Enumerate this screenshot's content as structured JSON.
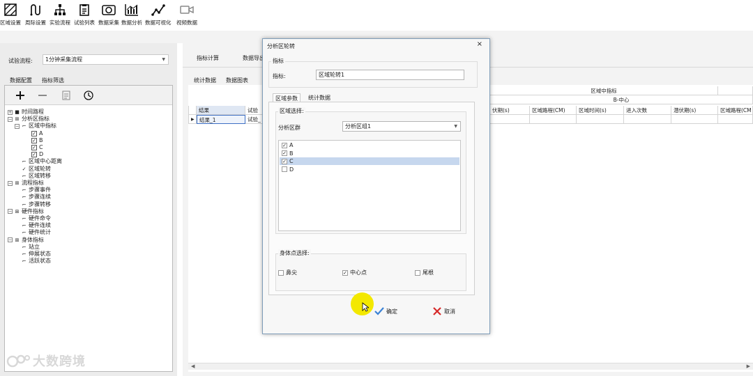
{
  "toolbar": {
    "items": [
      {
        "label": "区域设置",
        "icon": "region-hatch-icon"
      },
      {
        "label": "周际设置",
        "icon": "interval-cycle-icon"
      },
      {
        "label": "实验流程",
        "icon": "flow-tree-icon"
      },
      {
        "label": "试验列表",
        "icon": "clipboard-list-icon"
      },
      {
        "label": "数据采集",
        "icon": "camera-icon"
      },
      {
        "label": "数据分析",
        "icon": "bar-chart-icon"
      },
      {
        "label": "数据可视化",
        "icon": "line-chart-icon"
      },
      {
        "label": "视频数据",
        "icon": "video-icon"
      }
    ]
  },
  "left": {
    "flow_label": "试验流程:",
    "flow_value": "1分钟采集流程",
    "tabs": [
      "数据配置",
      "指标筛选"
    ],
    "active_tab": 1,
    "tree": [
      {
        "label": "时间路程",
        "level": 0,
        "kind": "root",
        "exp": "+",
        "glyph": "square"
      },
      {
        "label": "分析区指标",
        "level": 0,
        "kind": "root",
        "exp": "-",
        "glyph": "grid"
      },
      {
        "label": "区域中指标",
        "level": 1,
        "kind": "node",
        "exp": "-",
        "glyph": "doc"
      },
      {
        "label": "A",
        "level": 2,
        "kind": "check",
        "checked": true
      },
      {
        "label": "B",
        "level": 2,
        "kind": "check",
        "checked": true
      },
      {
        "label": "C",
        "level": 2,
        "kind": "check",
        "checked": true
      },
      {
        "label": "D",
        "level": 2,
        "kind": "check",
        "checked": true
      },
      {
        "label": "区域中心距离",
        "level": 1,
        "kind": "node",
        "glyph": "doc"
      },
      {
        "label": "区域轮转",
        "level": 1,
        "kind": "node",
        "glyph": "tick"
      },
      {
        "label": "区域转移",
        "level": 1,
        "kind": "node",
        "glyph": "doc"
      },
      {
        "label": "流程指标",
        "level": 0,
        "kind": "root",
        "exp": "-",
        "glyph": "grid"
      },
      {
        "label": "步骤事件",
        "level": 1,
        "kind": "node",
        "glyph": "doc"
      },
      {
        "label": "步骤连续",
        "level": 1,
        "kind": "node",
        "glyph": "doc"
      },
      {
        "label": "步骤转移",
        "level": 1,
        "kind": "node",
        "glyph": "doc"
      },
      {
        "label": "硬件指标",
        "level": 0,
        "kind": "root",
        "exp": "-",
        "glyph": "grid"
      },
      {
        "label": "硬件命令",
        "level": 1,
        "kind": "node",
        "glyph": "doc"
      },
      {
        "label": "硬件连续",
        "level": 1,
        "kind": "node",
        "glyph": "doc"
      },
      {
        "label": "硬件统计",
        "level": 1,
        "kind": "node",
        "glyph": "doc"
      },
      {
        "label": "身体指标",
        "level": 0,
        "kind": "root",
        "exp": "-",
        "glyph": "grid"
      },
      {
        "label": "站立",
        "level": 1,
        "kind": "node",
        "glyph": "doc"
      },
      {
        "label": "伸展状态",
        "level": 1,
        "kind": "node",
        "glyph": "doc"
      },
      {
        "label": "活跃状态",
        "level": 1,
        "kind": "node",
        "glyph": "doc"
      }
    ]
  },
  "right": {
    "top_tabs": [
      "指标计算",
      "数据导出"
    ],
    "sub_tabs": [
      "统计数据",
      "数据图表"
    ],
    "grid": {
      "group_header": "区域中指标",
      "sub_header": "B-中心",
      "columns": [
        "伏期(s)",
        "区域路程(CM)",
        "区域时间(s)",
        "进入次数",
        "潜伏期(s)",
        "区域路程(CM"
      ],
      "left_headers": [
        "结果",
        "试验"
      ],
      "rows": [
        [
          "结果_1",
          "试验_"
        ]
      ]
    }
  },
  "dialog": {
    "title": "分析区轮转",
    "close": "×",
    "metric_group": "指标",
    "metric_label": "指标:",
    "metric_value": "区域轮转1",
    "tabs": [
      "区域参数",
      "统计数据"
    ],
    "region_group": "区域选择:",
    "cluster_label": "分析区群",
    "cluster_value": "分析区组1",
    "regions": [
      {
        "label": "A",
        "checked": true,
        "selected": false
      },
      {
        "label": "B",
        "checked": true,
        "selected": false
      },
      {
        "label": "C",
        "checked": true,
        "selected": true
      },
      {
        "label": "D",
        "checked": false,
        "selected": false
      }
    ],
    "body_group": "身体点选择:",
    "body_points": [
      {
        "label": "鼻尖",
        "checked": false
      },
      {
        "label": "中心点",
        "checked": true
      },
      {
        "label": "尾根",
        "checked": false
      }
    ],
    "ok": "确定",
    "cancel": "取消"
  },
  "watermark": "大数跨境",
  "colors": {
    "accent": "#3d6fc4",
    "selection": "#c6d7ee",
    "ok": "#3b82d6",
    "cancel": "#d62828",
    "cursor_halo": "#f3e800"
  }
}
